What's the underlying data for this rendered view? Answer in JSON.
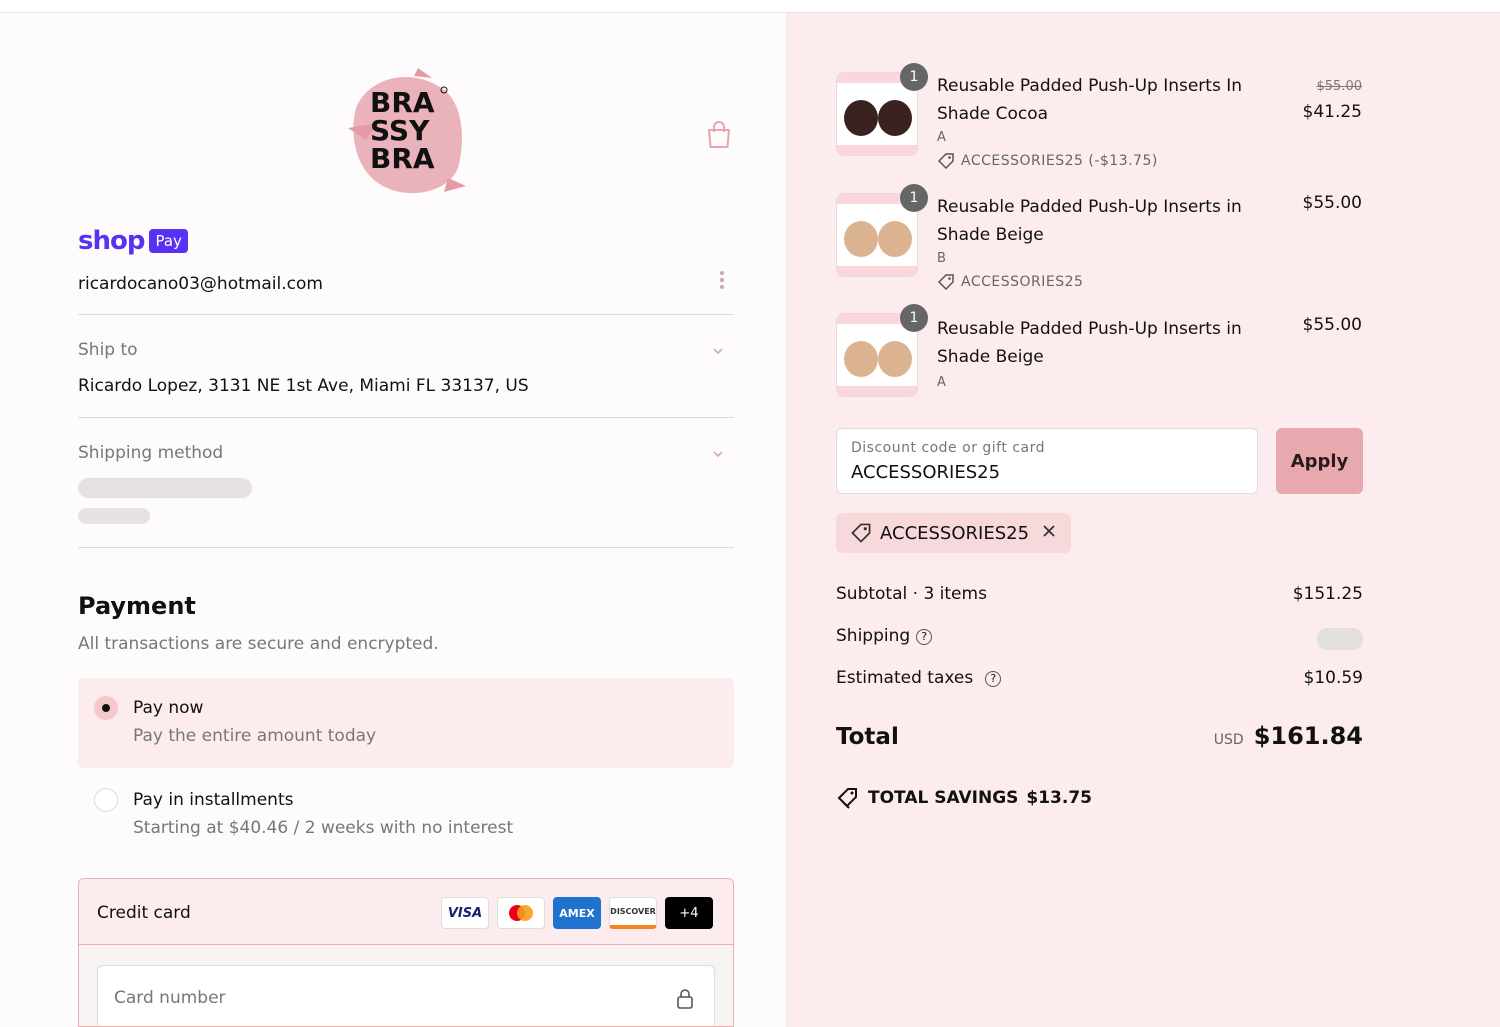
{
  "brand": {
    "logo_lines": [
      "BRA",
      "SSY",
      "BRA"
    ],
    "shop_pay_word": "shop",
    "shop_pay_badge": "Pay"
  },
  "contact": {
    "email": "ricardocano03@hotmail.com"
  },
  "ship_to": {
    "label": "Ship to",
    "value": "Ricardo Lopez, 3131 NE 1st Ave, Miami FL 33137, US"
  },
  "shipping_method": {
    "label": "Shipping method"
  },
  "payment": {
    "title": "Payment",
    "subtitle": "All transactions are secure and encrypted.",
    "options": [
      {
        "title": "Pay now",
        "desc": "Pay the entire amount today",
        "selected": true
      },
      {
        "title": "Pay in installments",
        "desc": "Starting at $40.46 / 2 weeks with no interest",
        "selected": false
      }
    ],
    "credit_card_label": "Credit card",
    "card_brands": [
      "VISA",
      "AMEX",
      "DISCOVER",
      "+4"
    ],
    "card_number_placeholder": "Card number"
  },
  "items": [
    {
      "qty": "1",
      "name": "Reusable Padded Push-Up Inserts In Shade Cocoa",
      "variant": "A",
      "discount": "ACCESSORIES25 (-$13.75)",
      "old_price": "$55.00",
      "price": "$41.25",
      "swatch": "#3a2220"
    },
    {
      "qty": "1",
      "name": "Reusable Padded Push-Up Inserts in Shade Beige",
      "variant": "B",
      "discount": "ACCESSORIES25",
      "old_price": "",
      "price": "$55.00",
      "swatch": "#dcb391"
    },
    {
      "qty": "1",
      "name": "Reusable Padded Push-Up Inserts in Shade Beige",
      "variant": "A",
      "discount": "",
      "old_price": "",
      "price": "$55.00",
      "swatch": "#dcb391"
    }
  ],
  "discount": {
    "label": "Discount code or gift card",
    "value": "ACCESSORIES25",
    "apply_label": "Apply",
    "applied_code": "ACCESSORIES25"
  },
  "summary": {
    "subtotal_label": "Subtotal · 3 items",
    "subtotal": "$151.25",
    "shipping_label": "Shipping",
    "taxes_label": "Estimated taxes",
    "taxes": "$10.59",
    "total_label": "Total",
    "currency": "USD",
    "total": "$161.84",
    "savings_label": "TOTAL SAVINGS",
    "savings": "$13.75"
  },
  "colors": {
    "accent": "#e8a9ae",
    "shop_pay": "#5a31f4",
    "panel": "#fceced"
  }
}
